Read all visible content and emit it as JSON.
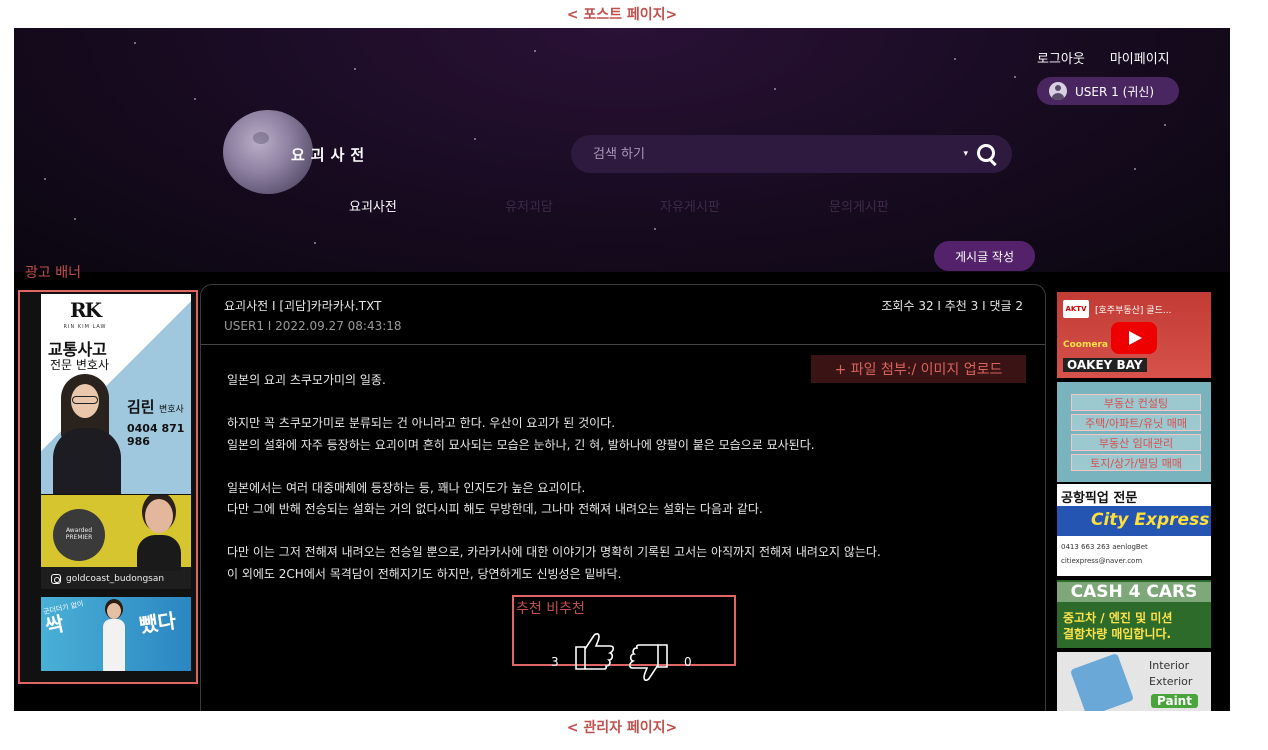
{
  "annotations": {
    "top": "< 포스트 페이지>",
    "bottom": "< 관리자 페이지>",
    "ad_banner": "광고 배너",
    "recommend": "추천 비추천",
    "file_upload": "+ 파일 첨부:/ 이미지 업로드"
  },
  "header": {
    "logout": "로그아웃",
    "mypage": "마이페이지",
    "user": "USER 1 (귀신)",
    "logo": "요괴사전"
  },
  "search": {
    "placeholder": "검색 하기",
    "dropdown_arrow": "▾"
  },
  "nav": {
    "items": [
      {
        "label": "요괴사전"
      },
      {
        "label": "유저괴담"
      },
      {
        "label": "자유게시판"
      },
      {
        "label": "문의게시판"
      }
    ]
  },
  "write_button": "게시글 작성",
  "post": {
    "crumb": "요괴사전  I  [괴담]카라카사.TXT",
    "meta": "USER1  I  2022.09.27 08:43:18",
    "stats": "조회수 32  I  추천 3  I  댓글 2",
    "body": [
      "일본의 요괴 츠쿠모가미의 일종.",
      "하지만 꼭 츠쿠모가미로 분류되는 건 아니라고 한다. 우산이 요괴가 된 것이다.",
      "일본의 설화에 자주 등장하는 요괴이며 흔히 묘사되는 모습은 눈하나, 긴 혀, 발하나에 양팔이 붙은 모습으로 묘사된다.",
      "일본에서는 여러 대중매체에 등장하는 등, 꽤나 인지도가 높은 요괴이다.",
      "다만 그에 반해 전승되는 설화는 거의 없다시피 해도 무방한데, 그나마 전해져 내려오는 설화는 다음과 같다.",
      "다만 이는 그저 전해져 내려오는 전승일 뿐으로, 카라카사에 대한 이야기가 명확히 기록된 고서는 아직까지 전해져 내려오지 않는다.",
      "이 외에도 2CH에서 목격담이 전해지기도 하지만, 당연하게도 신빙성은 밑바닥."
    ],
    "likes": "3",
    "dislikes": "0"
  },
  "ads_left": {
    "rk_logo": "RK",
    "rk_sub": "RIN KIM LAW",
    "rk_h1": "교통사고",
    "rk_h2": "전문 변호사",
    "rk_name": "김린",
    "rk_title": "변호사",
    "rk_phone": "0404 871 986",
    "gc_badge": "Awarded PREMIER",
    "gc_handle": "goldcoast_budongsan",
    "clean_small": "군더더기 없이",
    "clean_left": "싹",
    "clean_right": "뺐다"
  },
  "ads_right": {
    "yt_title": "[호주부동산] 골드...",
    "yt_logo": "AKTV",
    "yt_brand": "Coomera",
    "yt_bottom": "OAKEY BAY",
    "re_items": [
      "부동산 컨설팅",
      "주택/아파트/유닛 매매",
      "부동산 임대관리",
      "토지/상가/빌딩 매매"
    ],
    "city_top": "공항픽업 전문",
    "city_band": "City Express",
    "city_phone": "0413 663 263  aenlogBet",
    "city_email": "citiexpress@naver.com",
    "cash_title": "CASH 4 CARS",
    "cash_line1": "중고차 / 엔진 및 미션",
    "cash_line2": "결함차량 매입합니다.",
    "paint_line1": "Interior",
    "paint_line2": "Exterior",
    "paint_btn": "Paint"
  }
}
